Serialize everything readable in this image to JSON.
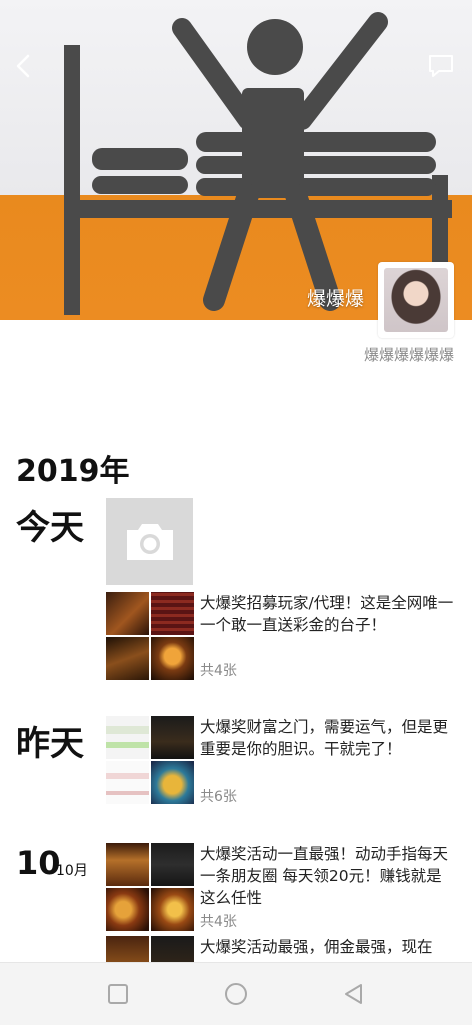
{
  "header": {
    "nickname": "爆爆爆",
    "signature": "爆爆爆爆爆爆"
  },
  "timeline": {
    "year": "2019年",
    "groups": [
      {
        "day": "今天",
        "posts": [
          {
            "text": "大爆奖招募玩家/代理！这是全网唯一一个敢一直送彩金的台子！",
            "count": "共4张"
          }
        ]
      },
      {
        "day": "昨天",
        "posts": [
          {
            "text": "大爆奖财富之门，需要运气，但是更重要是你的胆识。干就完了！",
            "count": "共6张"
          }
        ]
      },
      {
        "day_num": "10",
        "month": "10月",
        "posts": [
          {
            "text": "大爆奖活动一直最强！动动手指每天一条朋友圈 每天领20元！赚钱就是这么任性",
            "count": "共4张"
          },
          {
            "text": "大爆奖活动最强，佣金最强，现在"
          }
        ]
      }
    ]
  },
  "icons": {
    "back": "chevron-left-icon",
    "comment": "message-icon",
    "camera": "camera-icon",
    "nav": [
      "square-icon",
      "circle-icon",
      "triangle-back-icon"
    ]
  },
  "colors": {
    "cover_orange": "#e98a1e",
    "cover_figure": "#4a4a4a"
  }
}
